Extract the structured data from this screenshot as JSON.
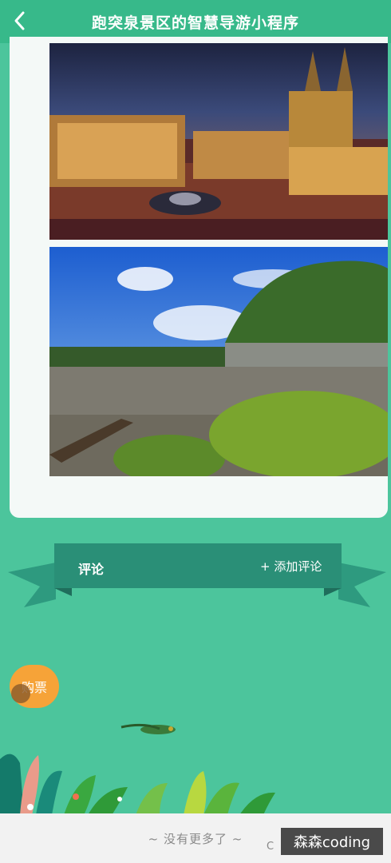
{
  "header": {
    "title": "跑突泉景区的智慧导游小程序",
    "back_icon": "chevron-left-icon"
  },
  "comments_section": {
    "title": "评论",
    "add_label": "+ 添加评论"
  },
  "floating_button": {
    "label": "购票"
  },
  "footer": {
    "no_more_text": "~ 没有更多了 ~",
    "watermark": "森森coding",
    "watermark_prefix": "C"
  },
  "colors": {
    "header_bg": "#37b98a",
    "page_bg": "#4cc59c",
    "ribbon": "#2a8f77",
    "ticket": "#f6a338"
  }
}
